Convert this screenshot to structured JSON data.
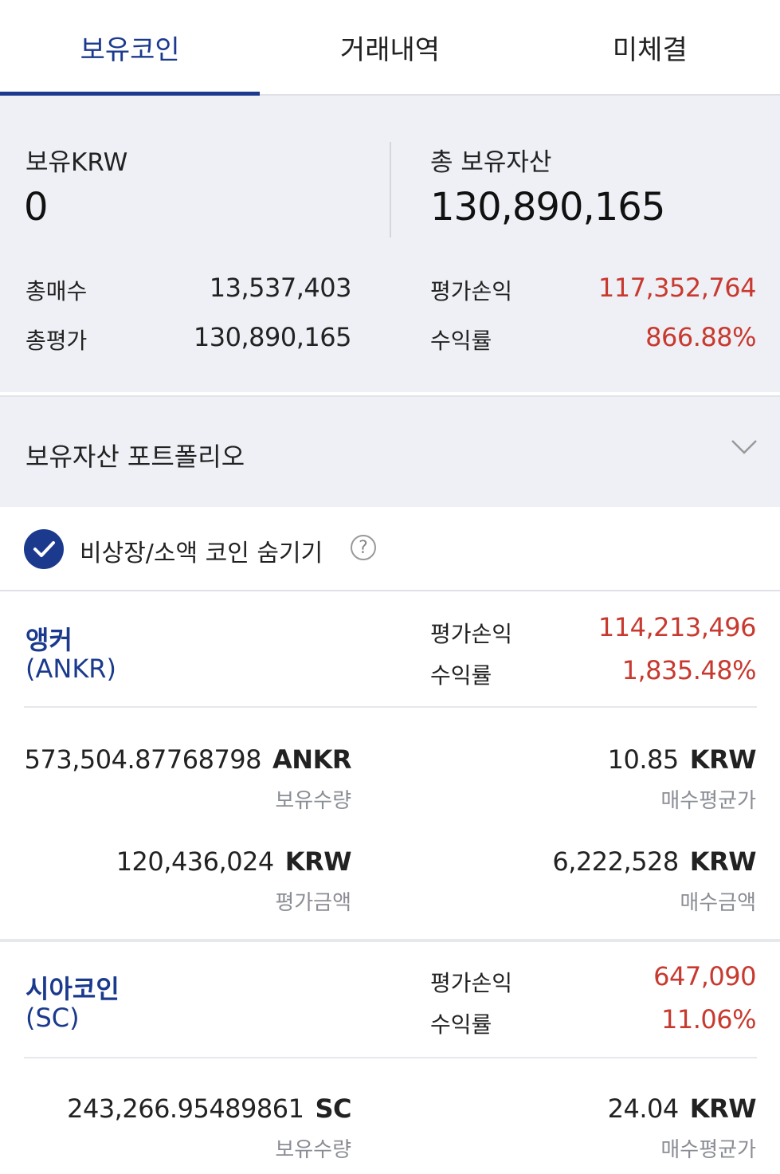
{
  "tabs": [
    {
      "label": "보유코인",
      "active": true
    },
    {
      "label": "거래내역",
      "active": false
    },
    {
      "label": "미체결",
      "active": false
    }
  ],
  "summary": {
    "krw_label": "보유KRW",
    "krw_value": "0",
    "total_label": "총 보유자산",
    "total_value": "130,890,165",
    "buy_total_label": "총매수",
    "buy_total_value": "13,537,403",
    "eval_total_label": "총평가",
    "eval_total_value": "130,890,165",
    "pnl_label": "평가손익",
    "pnl_value": "117,352,764",
    "rate_label": "수익률",
    "rate_value": "866.88%"
  },
  "portfolio": {
    "title": "보유자산 포트폴리오",
    "icon": "chevron-down-icon"
  },
  "hide_small": {
    "label": "비상장/소액 코인 숨기기",
    "checked": true,
    "help": "?"
  },
  "coins": [
    {
      "name": "앵커",
      "symbol": "(ANKR)",
      "pnl_label": "평가손익",
      "pnl": "114,213,496",
      "rate_label": "수익률",
      "rate": "1,835.48%",
      "qty": "573,504.87768798",
      "qty_unit": "ANKR",
      "qty_label": "보유수량",
      "avg_price": "10.85",
      "avg_unit": "KRW",
      "avg_label": "매수평균가",
      "eval_amount": "120,436,024",
      "eval_unit": "KRW",
      "eval_label": "평가금액",
      "buy_amount": "6,222,528",
      "buy_unit": "KRW",
      "buy_label": "매수금액"
    },
    {
      "name": "시아코인",
      "symbol": "(SC)",
      "pnl_label": "평가손익",
      "pnl": "647,090",
      "rate_label": "수익률",
      "rate": "11.06%",
      "qty": "243,266.95489861",
      "qty_unit": "SC",
      "qty_label": "보유수량",
      "avg_price": "24.04",
      "avg_unit": "KRW",
      "avg_label": "매수평균가"
    }
  ],
  "colors": {
    "accent": "#1b3a8e",
    "loss_gain_red": "#c8392f",
    "panel_bg": "#eef0f5"
  }
}
